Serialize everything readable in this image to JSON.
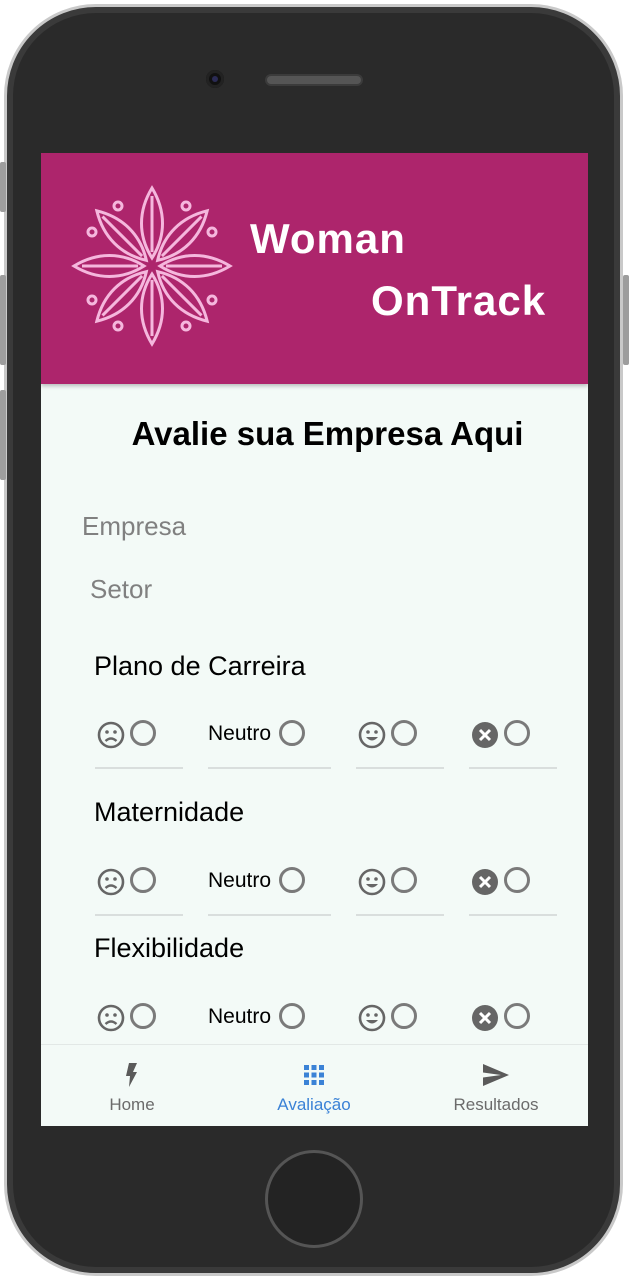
{
  "brand": {
    "line1": "Woman",
    "line2": "OnTrack"
  },
  "page_title": "Avalie sua Empresa Aqui",
  "form": {
    "empresa_placeholder": "Empresa",
    "setor_placeholder": "Setor"
  },
  "sections": [
    {
      "label": "Plano de Carreira",
      "neutral_label": "Neutro"
    },
    {
      "label": "Maternidade",
      "neutral_label": "Neutro"
    },
    {
      "label": "Flexibilidade",
      "neutral_label": "Neutro"
    }
  ],
  "icons": {
    "negative": "sad-face-icon",
    "positive": "happy-face-icon",
    "not_applicable": "close-circle-icon"
  },
  "nav": {
    "items": [
      {
        "label": "Home",
        "icon": "lightning-icon",
        "active": false
      },
      {
        "label": "Avaliação",
        "icon": "grid-icon",
        "active": true
      },
      {
        "label": "Resultados",
        "icon": "send-icon",
        "active": false
      }
    ]
  },
  "colors": {
    "header": "#ad256c",
    "screen_bg": "#f3faf7",
    "nav_active": "#3b82d6",
    "nav_inactive": "#6b6b6b"
  }
}
